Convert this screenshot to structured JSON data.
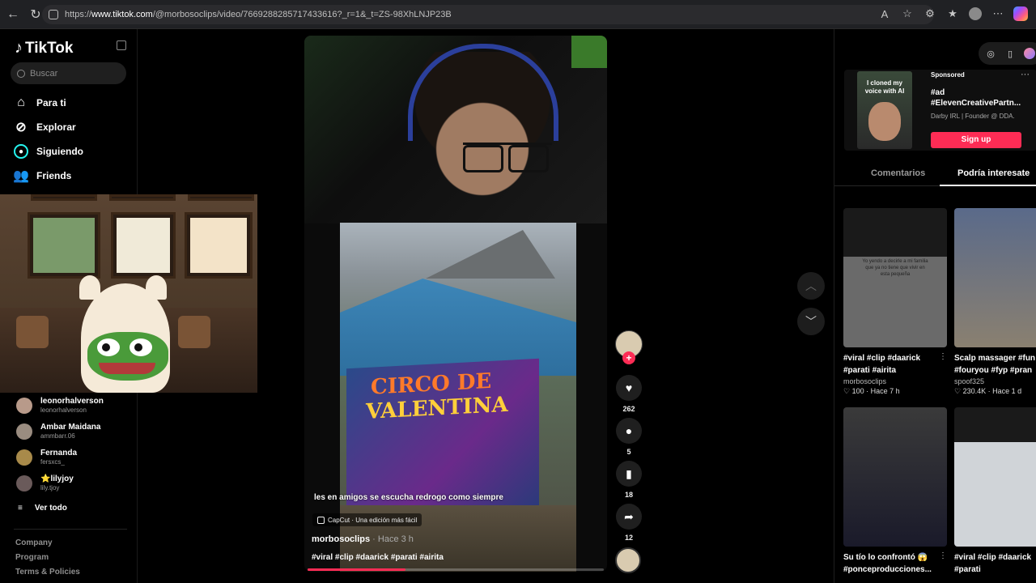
{
  "browser": {
    "url_prefix": "https://",
    "url_host": "www.tiktok.com",
    "url_path": "/@morbosoclips/video/7669288285717433616?_r=1&_t=ZS-98XhLNJP23B"
  },
  "sidebar": {
    "logo_text": "TikTok",
    "search_placeholder": "Buscar",
    "nav": [
      {
        "label": "Para ti",
        "icon": "home-icon"
      },
      {
        "label": "Explorar",
        "icon": "compass-icon"
      },
      {
        "label": "Siguiendo",
        "icon": "following-icon"
      },
      {
        "label": "Friends",
        "icon": "friends-icon"
      }
    ],
    "following": [
      {
        "name": "leonorhalverson",
        "handle": "leonorhalverson"
      },
      {
        "name": "Ambar Maidana",
        "handle": "ammbarr.06"
      },
      {
        "name": "Fernanda",
        "handle": "fersxcs_"
      },
      {
        "name": "⭐lilyjoy",
        "handle": "lily.tjoy"
      }
    ],
    "see_all": "Ver todo",
    "footer": [
      "Company",
      "Program",
      "Terms & Policies"
    ]
  },
  "video": {
    "banner_line1": "CIRCO DE",
    "banner_line2": "VALENTINA",
    "caption": "les en amigos se escucha redrogo como siempre",
    "capcut_label": "CapCut · Una edición más fácil",
    "author": "morbosoclips",
    "time": " · Hace 3 h",
    "tags": "#viral #clip #daarick #parati #airita",
    "progress": 0.33
  },
  "actions": {
    "likes": "262",
    "comments": "5",
    "saves": "18",
    "shares": "12"
  },
  "right": {
    "ad": {
      "sponsored": "Sponsored",
      "title": "#ad #ElevenCreativePartn...",
      "sub": "Darby IRL | Founder @ DDA.",
      "thumb_caption": "I cloned my voice with AI",
      "signup": "Sign up"
    },
    "tabs": {
      "comments": "Comentarios",
      "related": "Podría interesate"
    },
    "cards": [
      {
        "title1": "#viral #clip #daarick",
        "title2": "#parati #airita",
        "author": "morbosoclips",
        "stats": "♡ 100 · Hace 7 h",
        "thumb_text": "Yo yendo a decirle a mi familia que ya no tiene que vivir en esta pequeña"
      },
      {
        "title1": "Scalp massager #fun",
        "title2": "#fouryou #fyp #pran",
        "author": "spoof325",
        "stats": "♡ 230.4K · Hace 1 d"
      },
      {
        "title1": "Su tío lo confrontó 😱",
        "title2": "#ponceproducciones..."
      },
      {
        "title1": "#viral #clip #daarick",
        "title2": "#parati"
      }
    ]
  },
  "colors": {
    "accent": "#fe2c55",
    "background": "#000000"
  }
}
